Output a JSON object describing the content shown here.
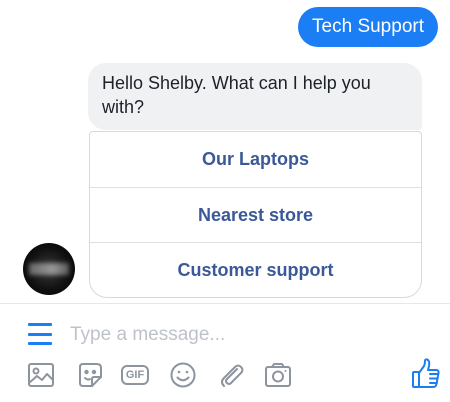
{
  "conversation": {
    "sent_message": "Tech Support",
    "received_message": "Hello Shelby. What can I help you with?",
    "quick_replies": [
      "Our Laptops",
      "Nearest store",
      "Customer support"
    ]
  },
  "composer": {
    "placeholder": "Type a message...",
    "toolbar_icons": [
      "image-icon",
      "sticker-icon",
      "gif-icon",
      "emoji-icon",
      "attachment-icon",
      "camera-icon",
      "like-icon"
    ],
    "gif_label": "GIF"
  },
  "colors": {
    "accent": "#1b7ef5",
    "quick_reply_text": "#3b5998",
    "received_bubble": "#f0f1f3",
    "icon_gray": "#8d949e"
  }
}
